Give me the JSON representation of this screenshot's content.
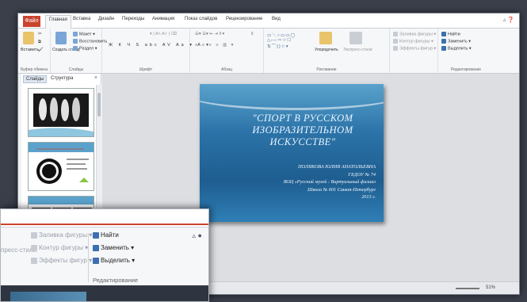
{
  "ribbon": {
    "file_tab": "Файл",
    "tabs": [
      "Главная",
      "Вставка",
      "Дизайн",
      "Переходы",
      "Анимация",
      "Показ слайдов",
      "Рецензирование",
      "Вид"
    ],
    "groups": {
      "clipboard": "Буфер обмена",
      "slides": "Слайды",
      "font": "Шрифт",
      "paragraph": "Абзац",
      "drawing": "Рисование",
      "editing": "Редактирование"
    },
    "clipboard": {
      "paste": "Вставить"
    },
    "slides": {
      "new_slide": "Создать слайд",
      "layout": "Макет",
      "reset": "Восстановить",
      "section": "Раздел"
    },
    "drawing": {
      "arrange": "Упорядочить",
      "quick_styles": "Экспресс-стили",
      "fill": "Заливка фигуры",
      "outline": "Контур фигуры",
      "effects": "Эффекты фигур"
    },
    "editing": {
      "find": "Найти",
      "replace": "Заменить",
      "select": "Выделить"
    }
  },
  "panel": {
    "tabs": [
      "Слайды",
      "Структура"
    ]
  },
  "slide": {
    "title": "\"СПОРТ В РУССКОМ ИЗОБРАЗИТЕЛЬНОМ ИСКУССТВЕ\"",
    "author": "ПОЛЯКОВА ЮЛИЯ АНАТОЛЬЕВНА",
    "org": "ГБДОУ № 74",
    "program": "ВОЦ «Русский музей : Виртуальный филиал",
    "school": "Школа № 601 Санкт-Петербург",
    "year": "2013 г."
  },
  "status": {
    "zoom": "51%"
  },
  "overlay": {
    "quick_styles": "пресс-стили",
    "fill": "Заливка фигуры",
    "outline": "Контур фигуры",
    "effects": "Эффекты фигур",
    "find": "Найти",
    "replace": "Заменить",
    "select": "Выделить",
    "group_label": "Редактирование"
  },
  "colors": {
    "file_tab": "#c9442e",
    "slide_blue": "#2b73a8",
    "app_bg": "#3a3f4a"
  }
}
